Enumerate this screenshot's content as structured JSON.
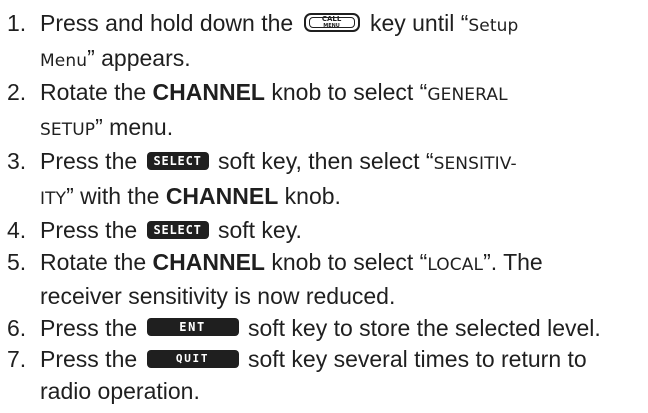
{
  "steps": [
    {
      "number": "1.",
      "line1_before_key": "Press and hold down the",
      "key_top": "CALL",
      "key_bottom": "MENU",
      "line1_after_key": "key until “",
      "lcd_line1": "Setup",
      "lcd_line2": "Menu",
      "line2_after_lcd": "” appears."
    },
    {
      "number": "2.",
      "line1_before_bold": "Rotate the",
      "bold": "CHANNEL",
      "line1_after_bold": "knob to select “",
      "lcd_line1": "GENERAL",
      "lcd_line2": "SETUP",
      "line2_after_lcd": "” menu."
    },
    {
      "number": "3.",
      "before_key": "Press the",
      "key": "SELECT",
      "after_key": "soft key, then select “",
      "lcd_line1": "SENSITIV-",
      "lcd_line2": "ITY",
      "line2_after_lcd": "” with the",
      "bold": "CHANNEL",
      "line2_end": "knob."
    },
    {
      "number": "4.",
      "before_key": "Press the",
      "key": "SELECT",
      "after_key": "soft key."
    },
    {
      "number": "5.",
      "line1_before_bold": "Rotate the",
      "bold": "CHANNEL",
      "line1_after_bold": "knob to select “",
      "lcd": "LOCAL",
      "line1_after_lcd": "”. The",
      "line2": "receiver sensitivity is now reduced."
    },
    {
      "number": "6.",
      "before_key": "Press the",
      "key": "ENT",
      "after_key": "soft key to store the selected level."
    },
    {
      "number": "7.",
      "before_key": "Press the",
      "key": "QUIT",
      "after_key": "soft key several times to return to",
      "line2": "radio operation."
    }
  ]
}
